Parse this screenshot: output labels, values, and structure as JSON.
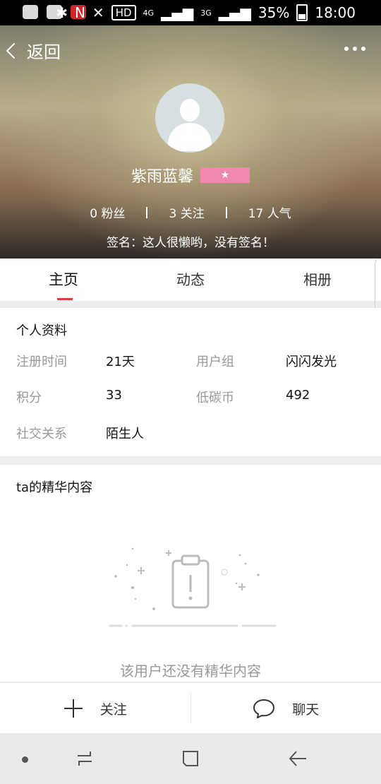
{
  "status_bar": {
    "hd": "HD",
    "network": "4G",
    "network2": "3G",
    "battery": "35%",
    "time": "18:00"
  },
  "header": {
    "back_label": "返回",
    "username": "紫雨蓝馨",
    "badge_icon": "★",
    "stats": {
      "fans": "0 粉丝",
      "following": "3 关注",
      "popularity": "17 人气"
    },
    "signature": "签名：这人很懒哟，没有签名！"
  },
  "tabs": [
    {
      "label": "主页"
    },
    {
      "label": "动态"
    },
    {
      "label": "相册"
    }
  ],
  "profile": {
    "title": "个人资料",
    "register_label": "注册时间",
    "register_value": "21天",
    "group_label": "用户组",
    "group_value": "闪闪发光",
    "points_label": "积分",
    "points_value": "33",
    "coins_label": "低碳币",
    "coins_value": "492",
    "relation_label": "社交关系",
    "relation_value": "陌生人"
  },
  "featured": {
    "title": "ta的精华内容",
    "empty_text": "该用户还没有精华内容"
  },
  "actions": {
    "follow_label": "关注",
    "chat_label": "聊天"
  },
  "colors": {
    "accent": "#e03a4a",
    "badge": "#f088b0"
  }
}
